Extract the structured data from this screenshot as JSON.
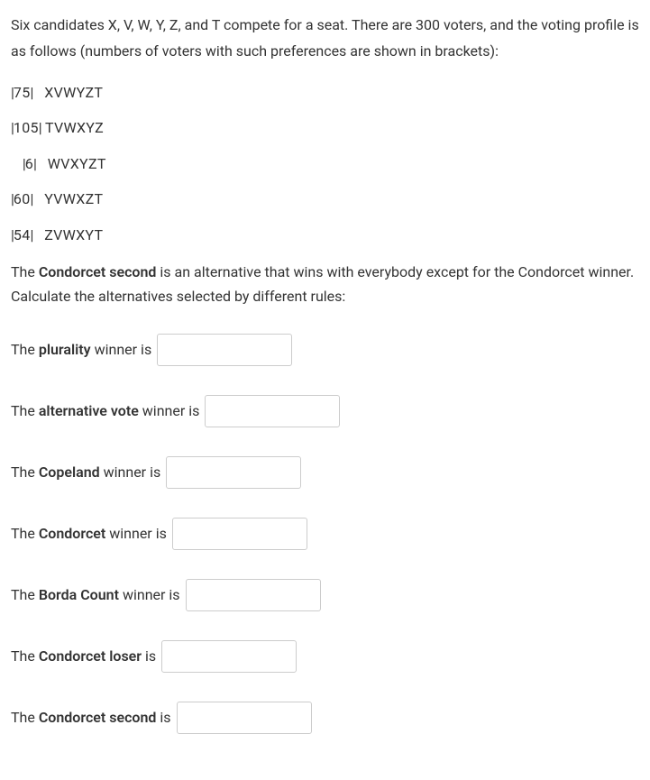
{
  "intro": "Six candidates X, V, W, Y,  Z, and T compete for a seat. There are 300 voters, and the voting profile is as follows (numbers of voters with such preferences are shown in brackets):",
  "profile": [
    {
      "count": "75",
      "order": "XVWYZT"
    },
    {
      "count": "105",
      "order": "TVWXYZ"
    },
    {
      "count": "6",
      "order": "WVXYZT"
    },
    {
      "count": "60",
      "order": "YVWXZT"
    },
    {
      "count": "54",
      "order": "ZVWXYT"
    }
  ],
  "description_pre": "The ",
  "description_bold": "Condorcet second",
  "description_post": " is an alternative that wins with everybody except for the Condorcet winner. Calculate the alternatives selected by different rules:",
  "questions": [
    {
      "pre": "The ",
      "bold": "plurality",
      "post": " winner is"
    },
    {
      "pre": "The ",
      "bold": "alternative vote",
      "post": " winner is"
    },
    {
      "pre": "The ",
      "bold": "Copeland",
      "post": " winner is"
    },
    {
      "pre": "The ",
      "bold": "Condorcet",
      "post": " winner is"
    },
    {
      "pre": "The ",
      "bold": "Borda Count",
      "post": " winner is"
    },
    {
      "pre": "The ",
      "bold": "Condorcet loser",
      "post": " is"
    },
    {
      "pre": "The ",
      "bold": "Condorcet second",
      "post": " is"
    }
  ]
}
